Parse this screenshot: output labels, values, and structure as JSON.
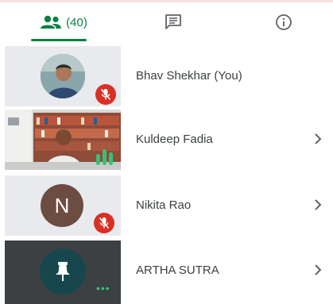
{
  "tabs": {
    "people_count": "(40)",
    "active": "people"
  },
  "participants": [
    {
      "name": "Bhav Shekhar (You)",
      "muted": true,
      "avatar_type": "photo",
      "has_chevron": false
    },
    {
      "name": "Kuldeep Fadia",
      "speaking": true,
      "avatar_type": "video",
      "has_chevron": true
    },
    {
      "name": "Nikita Rao",
      "muted": true,
      "avatar_type": "initial",
      "initial": "N",
      "avatar_color": "#6d4c41",
      "has_chevron": true
    },
    {
      "name": "ARTHA SUTRA",
      "avatar_type": "pin",
      "more_label": "•••",
      "has_chevron": true
    }
  ],
  "colors": {
    "accent": "#0b8043",
    "mute": "#d93025",
    "tile_dark": "#3c4043",
    "tile_light": "#e8eaed"
  },
  "icons": {
    "people": "people-icon",
    "chat": "chat-icon",
    "info": "info-icon",
    "mic_off": "mic-off-icon",
    "chevron": "chevron-right-icon",
    "pin": "pin-icon"
  }
}
